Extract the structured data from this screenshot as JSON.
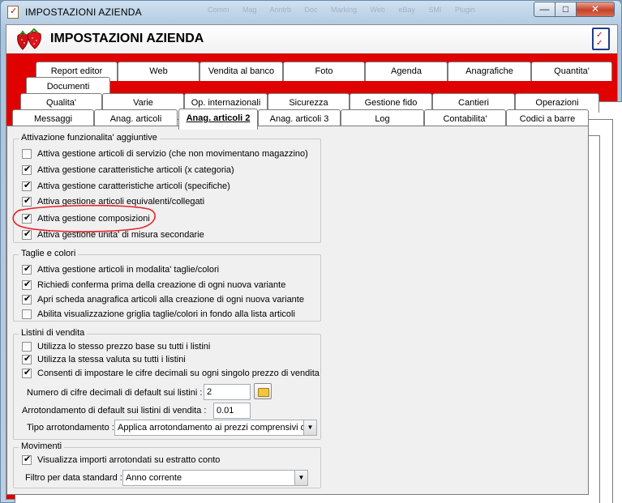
{
  "window": {
    "title": "IMPOSTAZIONI AZIENDA",
    "ghost_text": "Comm Mag Anntrb Doc Marking Web eBay SMI Plugin"
  },
  "header": {
    "title": "IMPOSTAZIONI AZIENDA"
  },
  "tabs": {
    "row1": [
      "Report editor",
      "Web",
      "Vendita al banco",
      "Foto",
      "Agenda",
      "Anagrafiche",
      "Quantita'"
    ],
    "row2": [
      "Documenti"
    ],
    "row3": [
      "Qualita'",
      "Varie",
      "Op. internazionali",
      "Sicurezza",
      "Gestione fido",
      "Cantieri",
      "Operazioni"
    ],
    "row4": [
      "Messaggi",
      "Anag. articoli",
      "Anag. articoli 2",
      "Anag. articoli 3",
      "Log",
      "Contabilita'",
      "Codici a barre"
    ],
    "active": "Anag. articoli 2"
  },
  "groups": {
    "funzionalita": {
      "label": "Attivazione funzionalita' aggiuntive",
      "items": [
        {
          "label": "Attiva gestione articoli di servizio (che non movimentano magazzino)",
          "checked": false
        },
        {
          "label": "Attiva gestione caratteristiche articoli (x categoria)",
          "checked": true
        },
        {
          "label": "Attiva gestione caratteristiche articoli (specifiche)",
          "checked": true
        },
        {
          "label": "Attiva gestione articoli equivalenti/collegati",
          "checked": true
        },
        {
          "label": "Attiva gestione composizioni",
          "checked": true
        },
        {
          "label": "Attiva gestione unita' di misura secondarie",
          "checked": true
        }
      ]
    },
    "taglie": {
      "label": "Taglie e colori",
      "items": [
        {
          "label": "Attiva gestione articoli in modalita' taglie/colori",
          "checked": true
        },
        {
          "label": "Richiedi conferma prima della creazione di ogni nuova variante",
          "checked": true
        },
        {
          "label": "Apri scheda anagrafica articoli alla creazione di ogni nuova variante",
          "checked": true
        },
        {
          "label": "Abilita visualizzazione griglia taglie/colori in fondo alla lista articoli",
          "checked": false
        }
      ]
    },
    "listini": {
      "label": "Listini di vendita",
      "items": [
        {
          "label": "Utilizza lo stesso prezzo base su tutti i listini",
          "checked": false
        },
        {
          "label": "Utilizza la stessa valuta su tutti i listini",
          "checked": true
        },
        {
          "label": "Consenti di impostare le cifre decimali su ogni singolo prezzo di vendita",
          "checked": true
        }
      ],
      "cifre_label": "Numero di cifre decimali di default sui listini :",
      "cifre_value": "2",
      "arrot_label": "Arrotondamento di default sui listini di vendita :",
      "arrot_value": "0.01",
      "tipo_label": "Tipo arrotondamento :",
      "tipo_value": "Applica arrotondamento ai prezzi comprensivi di i"
    },
    "movimenti": {
      "label": "Movimenti",
      "items": [
        {
          "label": "Visualizza importi arrotondati su estratto conto",
          "checked": true
        }
      ],
      "filtro_label": "Filtro per data standard :",
      "filtro_value": "Anno corrente"
    }
  },
  "colors": {
    "accent": "#e00000",
    "highlight_circle": "#e8202a"
  }
}
